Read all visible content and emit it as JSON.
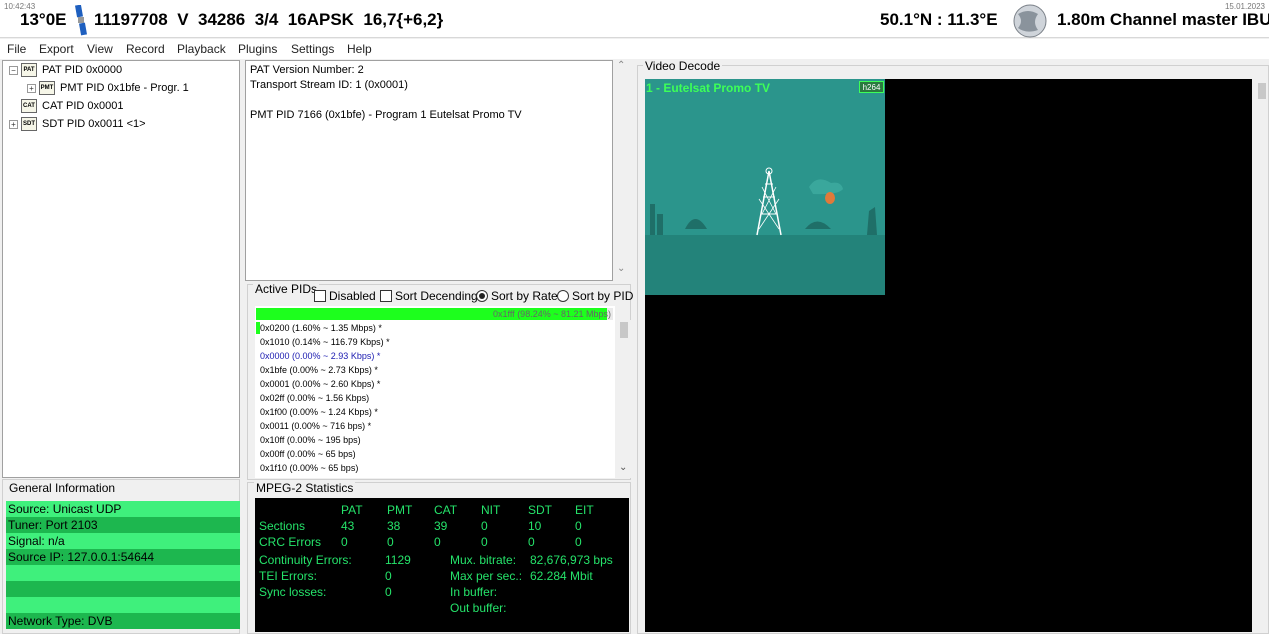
{
  "header": {
    "time": "10:42:43",
    "date": "15.01.2023",
    "orbital": "13°0E",
    "transponder": "11197708  V  34286  3/4  16APSK  16,7{+6,2}",
    "position": "50.1°N : 11.3°E",
    "dish": "1.80m Channel master IBU"
  },
  "menu": [
    "File",
    "Export",
    "View",
    "Record",
    "Playback",
    "Plugins",
    "Settings",
    "Help"
  ],
  "tree": [
    {
      "label": "PAT PID 0x0000",
      "expander": "−",
      "icon": "PAT"
    },
    {
      "label": "PMT PID 0x1bfe - Progr. 1",
      "expander": "+",
      "icon": "PMT"
    },
    {
      "label": "CAT PID 0x0001",
      "expander": "",
      "icon": "CAT"
    },
    {
      "label": "SDT PID 0x0011 <1>",
      "expander": "+",
      "icon": "SDT"
    }
  ],
  "info": {
    "lines": [
      "PAT Version Number: 2",
      "Transport Stream ID: 1 (0x0001)",
      "",
      "PMT PID 7166 (0x1bfe) - Program 1 Eutelsat Promo TV"
    ]
  },
  "active_pids": {
    "title": "Active PIDs",
    "options": {
      "disabled": "Disabled",
      "sort_desc": "Sort Decending",
      "sort_rate": "Sort by Rate",
      "sort_pid": "Sort by PID"
    },
    "top_bar": {
      "label": "0x1fff (98.24% ~ 81.21 Mbps)",
      "fraction": 0.9824
    },
    "rows": [
      {
        "text": "0x0200 (1.60% ~ 1.35 Mbps) *",
        "color": "#000000"
      },
      {
        "text": "0x1010 (0.14% ~ 116.79 Kbps) *",
        "color": "#000000"
      },
      {
        "text": "0x0000 (0.00% ~ 2.93 Kbps) *",
        "color": "#1a1ab0"
      },
      {
        "text": "0x1bfe (0.00% ~ 2.73 Kbps) *",
        "color": "#000000"
      },
      {
        "text": "0x0001 (0.00% ~ 2.60 Kbps) *",
        "color": "#000000"
      },
      {
        "text": "0x02ff (0.00% ~ 1.56 Kbps)",
        "color": "#000000"
      },
      {
        "text": "0x1f00 (0.00% ~ 1.24 Kbps) *",
        "color": "#000000"
      },
      {
        "text": "0x0011 (0.00% ~ 716 bps) *",
        "color": "#000000"
      },
      {
        "text": "0x10ff (0.00% ~ 195 bps)",
        "color": "#000000"
      },
      {
        "text": "0x00ff (0.00% ~ 65 bps)",
        "color": "#000000"
      },
      {
        "text": "0x1f10 (0.00% ~ 65 bps)",
        "color": "#000000"
      }
    ]
  },
  "general_info": {
    "title": "General Information",
    "rows": [
      "Source: Unicast UDP",
      "Tuner: Port 2103",
      "Signal: n/a",
      "Source IP: 127.0.0.1:54644",
      "",
      "",
      "",
      "Network Type: DVB"
    ]
  },
  "mpeg": {
    "title": "MPEG-2 Statistics",
    "columns": [
      "PAT",
      "PMT",
      "CAT",
      "NIT",
      "SDT",
      "EIT"
    ],
    "sections_label": "Sections",
    "sections": [
      "43",
      "38",
      "39",
      "0",
      "10",
      "0"
    ],
    "crc_label": "CRC Errors",
    "crc": [
      "0",
      "0",
      "0",
      "0",
      "0",
      "0"
    ],
    "cont_label": "Continuity Errors:",
    "cont_value": "1129",
    "tei_label": "TEI Errors:",
    "tei_value": "0",
    "sync_label": "Sync losses:",
    "sync_value": "0",
    "mux_label": "Mux. bitrate:",
    "mux_value": "82,676,973 bps",
    "maxsec_label": "Max per sec.:",
    "maxsec_value": "62.284 Mbit",
    "inbuf_label": "In buffer:",
    "outbuf_label": "Out buffer:"
  },
  "video": {
    "title": "Video Decode",
    "channel": "1 - Eutelsat Promo TV",
    "codec": "h264"
  }
}
